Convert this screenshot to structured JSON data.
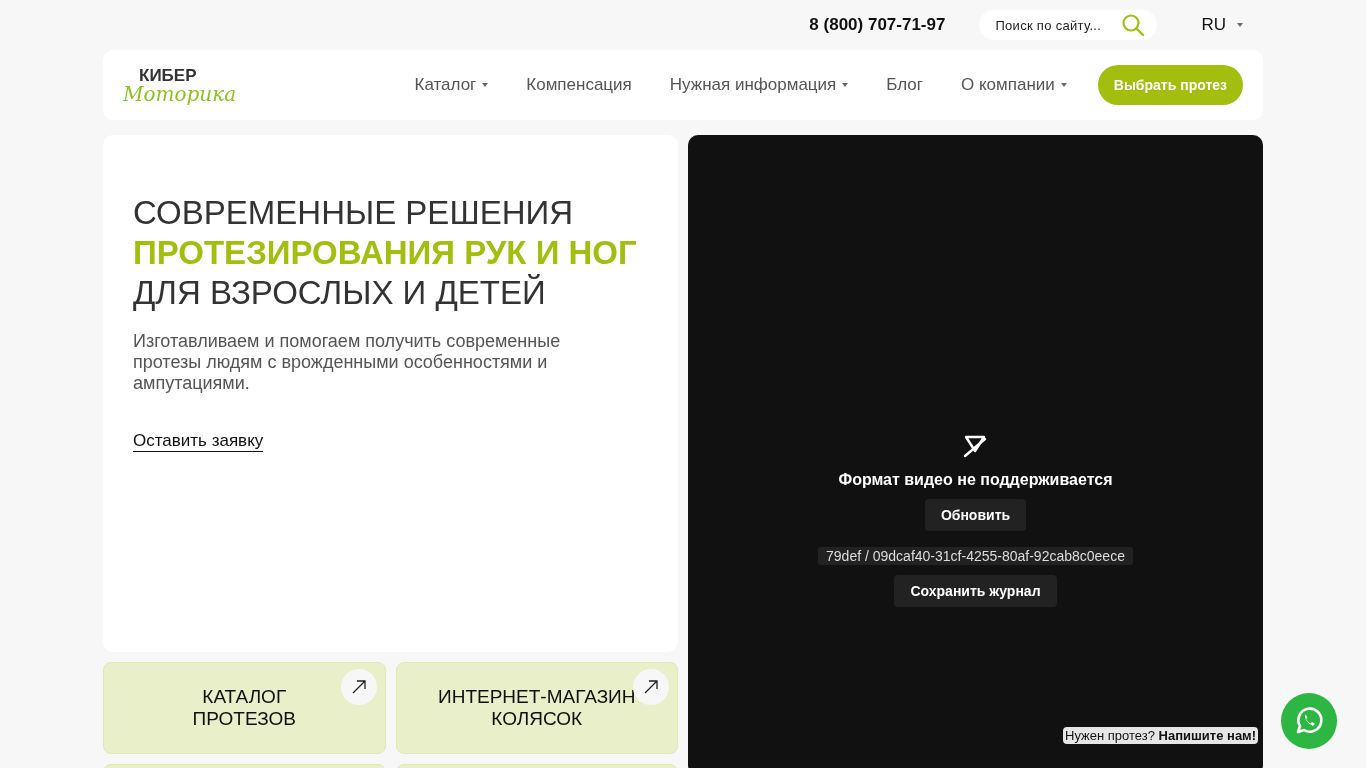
{
  "top_bar": {
    "phone": "8 (800) 707-71-97",
    "search": {
      "placeholder": "Поиск по сайту..."
    },
    "language": "RU"
  },
  "header": {
    "logo": {
      "line_1": "КИБЕР",
      "line_2": "Моторика"
    },
    "nav": [
      {
        "label": "Каталог",
        "has_dropdown": true
      },
      {
        "label": "Компенсация",
        "has_dropdown": false
      },
      {
        "label": "Нужная информация",
        "has_dropdown": true
      },
      {
        "label": "Блог",
        "has_dropdown": false
      },
      {
        "label": "О компании",
        "has_dropdown": true
      }
    ],
    "cta_button": "Выбрать протез"
  },
  "hero": {
    "title_lines": [
      {
        "text": "СОВРЕМЕННЫЕ РЕШЕНИЯ",
        "accent": false
      },
      {
        "text": "ПРОТЕЗИРОВАНИЯ РУК И НОГ",
        "accent": true
      },
      {
        "text": "ДЛЯ ВЗРОСЛЫХ И ДЕТЕЙ",
        "accent": false
      }
    ],
    "description": "Изготавливаем и помогаем получить современные протезы людям с врожденными особенностями и ампутациями.",
    "link": "Оставить заявку"
  },
  "tiles": [
    {
      "title_lines": [
        "КАТАЛОГ",
        "ПРОТЕЗОВ"
      ]
    },
    {
      "title_lines": [
        "ИНТЕРНЕТ-МАГАЗИН",
        "КОЛЯСОК"
      ]
    }
  ],
  "video": {
    "message": "Формат видео не поддерживается",
    "reload_button": "Обновить",
    "error_id": "79def / 09dcaf40-31cf-4255-80af-92cab8c0eece",
    "save_log_button": "Сохранить журнал"
  },
  "chat_prompt": {
    "text": "Нужен протез? **Напишите нам!**"
  }
}
